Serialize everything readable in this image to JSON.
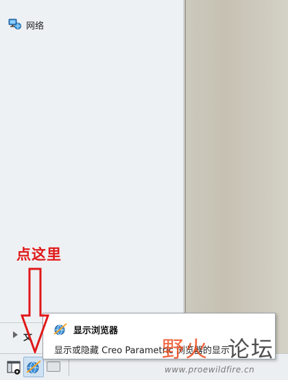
{
  "navigator": {
    "network_label": "网络",
    "folder_tree_label": "文"
  },
  "tooltip": {
    "title": "显示浏览器",
    "description": "显示或隐藏 Creo Parametric 浏览器的显示"
  },
  "annotation": {
    "text": "点这里",
    "color": "#e01818"
  },
  "watermark": {
    "text_left": "野火",
    "text_right": "论坛",
    "url": "www.proewildfire.cn"
  },
  "statusbar": {
    "buttons": [
      "navigator-toggle",
      "browser-toggle",
      "full-screen"
    ]
  },
  "icons": {
    "network": "network-icon",
    "browser": "browser-globe-icon",
    "navigator": "navigator-panel-icon"
  }
}
